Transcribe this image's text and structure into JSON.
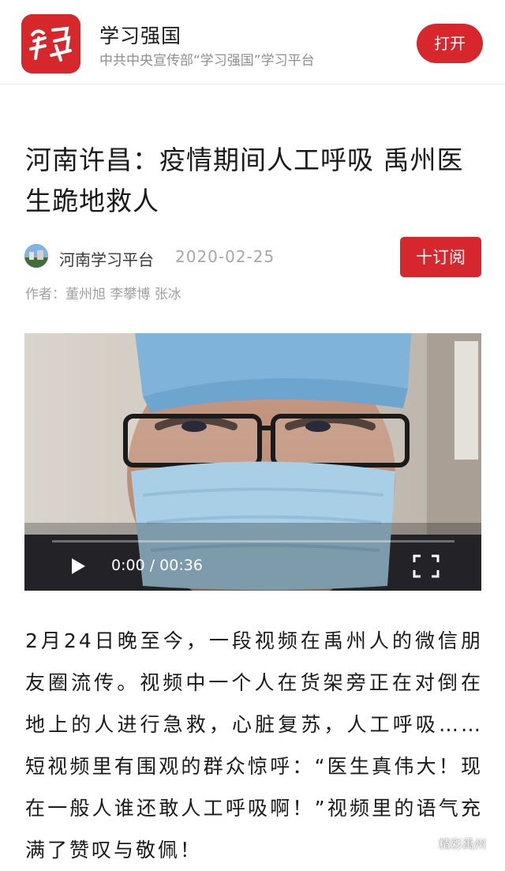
{
  "banner": {
    "app_name": "学习强国",
    "app_subtitle": "中共中央宣传部“学习强国”学习平台",
    "open_label": "打开",
    "logo_text": "学习",
    "accent": "#d6282b"
  },
  "article": {
    "title": "河南许昌：疫情期间人工呼吸 禹州医生跪地救人",
    "source": "河南学习平台",
    "date": "2020-02-25",
    "subscribe_label": "十订阅",
    "authors": "作者：董州旭 李攀博 张冰",
    "body": "2月24日晚至今，一段视频在禹州人的微信朋友圈流传。视频中一个人在货架旁正在对倒在地上的人进行急救，心脏复苏，人工呼吸……短视频里有围观的群众惊呼：“医生真伟大！现在一般人谁还敢人工呼吸啊！”视频里的语气充满了赞叹与敬佩！"
  },
  "video": {
    "time": "0:00 / 00:36",
    "progress": 0,
    "play_icon": "play-icon",
    "fullscreen_icon": "fullscreen-icon"
  },
  "watermark": {
    "text": "精彩禹州",
    "icon": "wechat-icon"
  }
}
